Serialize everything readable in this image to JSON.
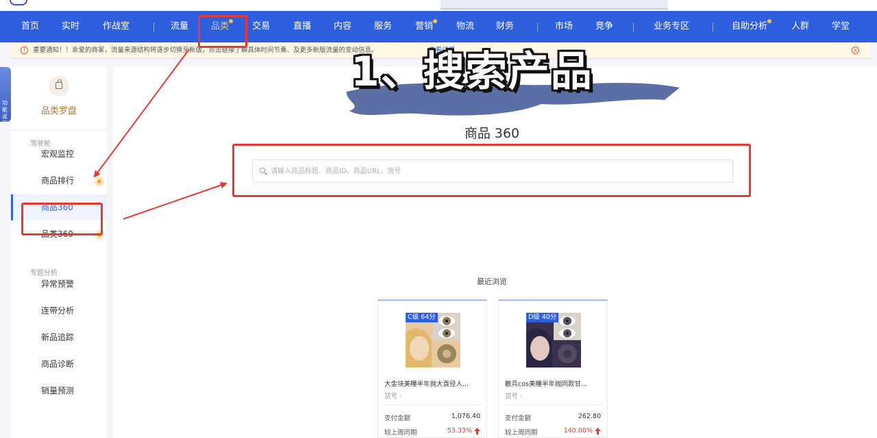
{
  "nav": {
    "items": [
      {
        "label": "首页",
        "dot": false,
        "active": false
      },
      {
        "label": "实时",
        "dot": false,
        "active": false
      },
      {
        "label": "作战室",
        "dot": false,
        "active": false
      },
      {
        "label": "流量",
        "dot": false,
        "active": false
      },
      {
        "label": "品类",
        "dot": true,
        "active": true
      },
      {
        "label": "交易",
        "dot": false,
        "active": false
      },
      {
        "label": "直播",
        "dot": false,
        "active": false
      },
      {
        "label": "内容",
        "dot": false,
        "active": false
      },
      {
        "label": "服务",
        "dot": false,
        "active": false
      },
      {
        "label": "营销",
        "dot": true,
        "active": false
      },
      {
        "label": "物流",
        "dot": false,
        "active": false
      },
      {
        "label": "财务",
        "dot": false,
        "active": false
      },
      {
        "label": "市场",
        "dot": false,
        "active": false
      },
      {
        "label": "竞争",
        "dot": false,
        "active": false
      },
      {
        "label": "业务专区",
        "dot": false,
        "active": false
      },
      {
        "label": "自助分析",
        "dot": true,
        "active": false
      },
      {
        "label": "人群",
        "dot": false,
        "active": false
      },
      {
        "label": "学堂",
        "dot": false,
        "active": false
      }
    ]
  },
  "notice": {
    "text": "重要通知！！亲爱的商家，流量来源结构将逐步切换至新版，点击链接了解具体时间节奏、及更多新版流量的变动信息。",
    "link": "查看详情"
  },
  "mascot": {
    "label": "功能说明"
  },
  "sidebar": {
    "title": "品类罗盘",
    "groups": [
      {
        "label": "驾驶舱",
        "items": [
          {
            "label": "宏观监控",
            "badge": false,
            "active": false
          },
          {
            "label": "商品排行",
            "badge": true,
            "active": false
          },
          {
            "label": "商品360",
            "badge": false,
            "active": true
          },
          {
            "label": "品类360",
            "badge": true,
            "active": false
          }
        ]
      },
      {
        "label": "专题分析",
        "items": [
          {
            "label": "异常预警",
            "badge": false,
            "active": false
          },
          {
            "label": "连带分析",
            "badge": false,
            "active": false
          },
          {
            "label": "新品追踪",
            "badge": false,
            "active": false
          },
          {
            "label": "商品诊断",
            "badge": false,
            "active": false
          },
          {
            "label": "销量预测",
            "badge": false,
            "active": false
          }
        ]
      }
    ]
  },
  "overlay_title": "1、搜索产品",
  "main": {
    "heading": "商品 360",
    "search_placeholder": "请输入商品标题、商品ID、商品URL、货号",
    "recent_title": "最近浏览"
  },
  "products": [
    {
      "tag": "C级 64分",
      "name": "大金块美瞳半年抛大直径人...",
      "sku": "货号 -",
      "pay_label": "支付金额",
      "pay_value": "1,076.40",
      "cmp_label": "较上周同期",
      "cmp_value": "53.33%",
      "colors": {
        "bg": "#e9c9a0",
        "face": "#f1d7b9",
        "hair": "#e3b86c",
        "lens": "#8b7a54"
      }
    },
    {
      "tag": "D级 40分",
      "name": "散兵cos美瞳半年抛同款甘...",
      "sku": "货号 -",
      "pay_label": "支付金额",
      "pay_value": "262.80",
      "cmp_label": "较上周同期",
      "cmp_value": "140.00%",
      "colors": {
        "bg": "#3a2f4c",
        "face": "#e2c7c2",
        "hair": "#2a2540",
        "lens": "#595062"
      }
    }
  ],
  "colors": {
    "nav_bg": "#2d5fde",
    "accent_red": "#e53935",
    "active_nav": "#f7c36a"
  }
}
